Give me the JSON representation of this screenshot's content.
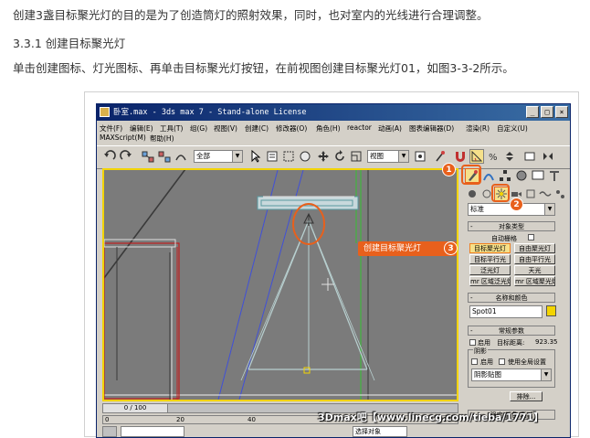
{
  "doc": {
    "line1": "创建3盏目标聚光灯的目的是为了创造筒灯的照射效果，同时，也对室内的光线进行合理调整。",
    "heading": "3.3.1 创建目标聚光灯",
    "line3": "单击创建图标、灯光图标、再单击目标聚光灯按钮，在前视图创建目标聚光灯01，如图3-3-2所示。"
  },
  "app": {
    "title": "卧室.max - 3ds max 7 - Stand-alone License",
    "window_buttons": [
      "_",
      "□",
      "×"
    ],
    "menu_row1": [
      "文件(F)",
      "编辑(E)",
      "工具(T)",
      "组(G)",
      "视图(V)",
      "创建(C)",
      "修改器(O)",
      "角色(H)",
      "reactor",
      "动画(A)",
      "图表编辑器(D)",
      "渲染(R)",
      "自定义(U)"
    ],
    "menu_row2": [
      "MAXScript(M)",
      "帮助(H)"
    ],
    "toolbar": {
      "selection_filter": "全部",
      "ref_coord": "视图"
    },
    "timeline": {
      "frame": "0 / 100",
      "ticks": [
        "0",
        "20",
        "40",
        "60",
        "80",
        "100"
      ]
    },
    "status": {
      "select_object": "选择对象"
    }
  },
  "panel": {
    "dropdown": "标准",
    "object_type_header": "对象类型",
    "auto_grid": "自动栅格",
    "buttons": [
      "目标聚光灯",
      "自由聚光灯",
      "目标平行光",
      "自由平行光",
      "泛光灯",
      "天光",
      "mr 区域泛光灯",
      "mr 区域聚光灯"
    ],
    "name_color_header": "名称和颜色",
    "object_name": "Spot01",
    "name_color_swatch": "#f3d400",
    "general_params_header": "常规参数",
    "on_label": "启用",
    "target_distance_label": "目标距离:",
    "target_distance_value": "923.35",
    "shadows_label": "阴影",
    "shadow_on_label": "启用",
    "global_settings_label": "使用全局设置",
    "shadow_type": "阴影贴图",
    "exclude_button": "排除...",
    "intensity_header": "强度/颜色/衰减"
  },
  "annotations": {
    "badge1": "1",
    "badge2": "2",
    "badge3": "3",
    "callout": "创建目标聚光灯",
    "accent": "#e8601c"
  },
  "watermark": "3Dmax吧【www.linecg.com/tieba/1771】"
}
